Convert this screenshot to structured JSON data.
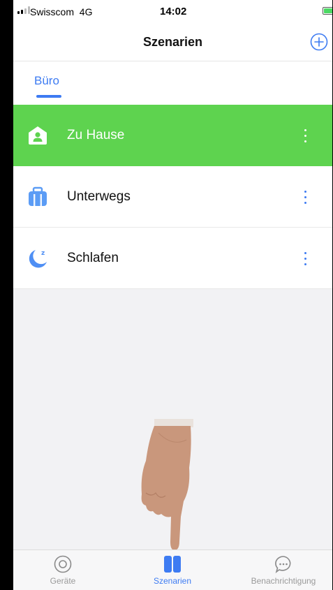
{
  "status_bar": {
    "carrier": "Swisscom",
    "network": "4G",
    "time": "14:02"
  },
  "nav": {
    "title": "Szenarien",
    "add_icon": "plus-circle-icon"
  },
  "tabs": [
    {
      "label": "Büro",
      "active": true
    }
  ],
  "scenes": [
    {
      "label": "Zu Hause",
      "icon": "home-person-icon",
      "active": true
    },
    {
      "label": "Unterwegs",
      "icon": "suitcase-icon",
      "active": false
    },
    {
      "label": "Schlafen",
      "icon": "moon-sleep-icon",
      "active": false
    }
  ],
  "bottom_nav": [
    {
      "label": "Geräte",
      "icon": "device-circle-icon",
      "active": false
    },
    {
      "label": "Szenarien",
      "icon": "scenes-icon",
      "active": true
    },
    {
      "label": "Benachrichtigung",
      "icon": "chat-bubble-icon",
      "active": false
    }
  ],
  "colors": {
    "accent": "#3d7bf2",
    "active_scene": "#5ed34f"
  }
}
